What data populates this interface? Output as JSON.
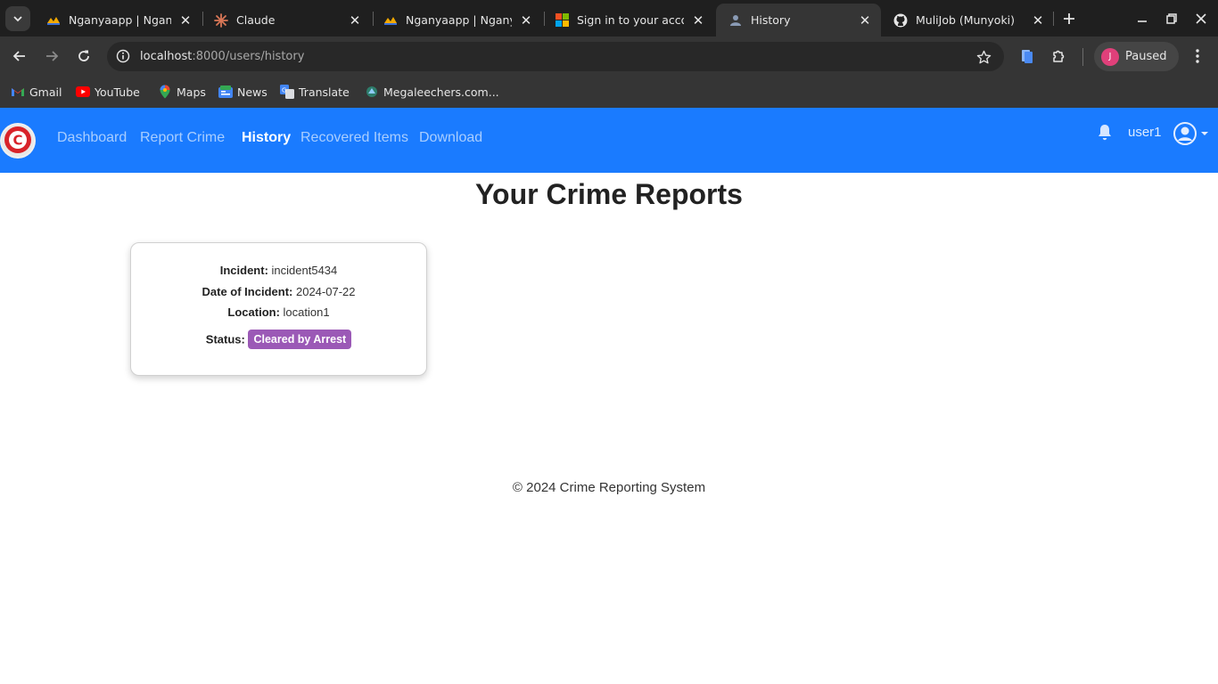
{
  "browser": {
    "tabs": [
      {
        "title": "Nganyaapp | Nganya",
        "icon": "nganya-favicon-icon",
        "active": false
      },
      {
        "title": "Claude",
        "icon": "claude-favicon-icon",
        "active": false
      },
      {
        "title": "Nganyaapp | Nganya",
        "icon": "nganya-favicon-icon",
        "active": false
      },
      {
        "title": "Sign in to your accou",
        "icon": "microsoft-favicon-icon",
        "active": false
      },
      {
        "title": "History",
        "icon": "history-favicon-icon",
        "active": true
      },
      {
        "title": "MuliJob (Munyoki)",
        "icon": "github-favicon-icon",
        "active": false
      }
    ],
    "address": {
      "host": "localhost",
      "path": ":8000/users/history"
    },
    "profile": {
      "initial": "J",
      "status": "Paused",
      "color": "#e0407a"
    },
    "bookmarks": [
      {
        "label": "Gmail",
        "icon": "gmail-icon"
      },
      {
        "label": "YouTube",
        "icon": "youtube-icon"
      },
      {
        "label": "Maps",
        "icon": "maps-icon"
      },
      {
        "label": "News",
        "icon": "news-icon"
      },
      {
        "label": "Translate",
        "icon": "translate-icon"
      },
      {
        "label": "Megaleechers.com...",
        "icon": "megaleechers-icon"
      }
    ]
  },
  "site": {
    "brand_color": "#1a7bff",
    "logo_letter": "C",
    "nav": [
      {
        "label": "Dashboard",
        "active": false
      },
      {
        "label": "Report Crime",
        "active": false
      },
      {
        "label": "History",
        "active": true
      },
      {
        "label": "Recovered Items",
        "active": false
      },
      {
        "label": "Download",
        "active": false
      }
    ],
    "user": "user1"
  },
  "main": {
    "title": "Your Crime Reports",
    "reports": [
      {
        "incident_label": "Incident:",
        "incident": "incident5434",
        "date_label": "Date of Incident:",
        "date": "2024-07-22",
        "location_label": "Location:",
        "location": "location1",
        "status_label": "Status:",
        "status": "Cleared by Arrest",
        "status_color": "#9b59b6"
      }
    ]
  },
  "footer": {
    "text": "© 2024 Crime Reporting System"
  }
}
